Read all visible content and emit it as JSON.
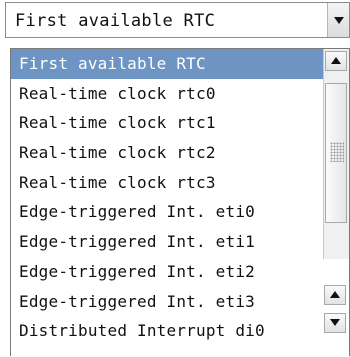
{
  "combo": {
    "value": "First available RTC",
    "arrow_icon": "triangle-down"
  },
  "dropdown": {
    "items": [
      {
        "label": "First available RTC",
        "selected": true
      },
      {
        "label": "Real-time clock rtc0",
        "selected": false
      },
      {
        "label": "Real-time clock rtc1",
        "selected": false
      },
      {
        "label": "Real-time clock rtc2",
        "selected": false
      },
      {
        "label": "Real-time clock rtc3",
        "selected": false
      },
      {
        "label": "Edge-triggered Int. eti0",
        "selected": false
      },
      {
        "label": "Edge-triggered Int. eti1",
        "selected": false
      },
      {
        "label": "Edge-triggered Int. eti2",
        "selected": false
      },
      {
        "label": "Edge-triggered Int. eti3",
        "selected": false
      },
      {
        "label": "Distributed Interrupt di0",
        "selected": false
      }
    ]
  },
  "colors": {
    "selection_bg": "#6d94c2",
    "selection_text": "#ffffff"
  }
}
